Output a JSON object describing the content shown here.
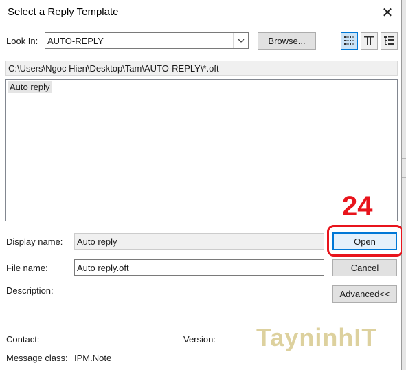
{
  "window": {
    "title": "Select a Reply Template",
    "close_glyph": "✕"
  },
  "look_in": {
    "label": "Look In:",
    "value": "AUTO-REPLY",
    "browse_label": "Browse...",
    "view_buttons": [
      "list-view-icon",
      "details-view-icon",
      "tree-view-icon"
    ]
  },
  "path": "C:\\Users\\Ngoc Hien\\Desktop\\Tam\\AUTO-REPLY\\*.oft",
  "templates": [
    {
      "name": "Auto reply"
    }
  ],
  "display_name": {
    "label": "Display name:",
    "value": "Auto reply"
  },
  "file_name": {
    "label": "File name:",
    "value": "Auto reply.oft"
  },
  "description": {
    "label": "Description:"
  },
  "buttons": {
    "open": "Open",
    "cancel": "Cancel",
    "advanced": "Advanced<<"
  },
  "info": {
    "contact_label": "Contact:",
    "version_label": "Version:",
    "message_class_label": "Message class:",
    "message_class_value": "IPM.Note"
  },
  "annotation": {
    "step_number": "24",
    "color": "#e8141c"
  },
  "watermark": "TayninhIT",
  "colors": {
    "accent": "#0078d7",
    "button_face": "#e1e1e1",
    "selected_item": "#e5e5e5"
  }
}
